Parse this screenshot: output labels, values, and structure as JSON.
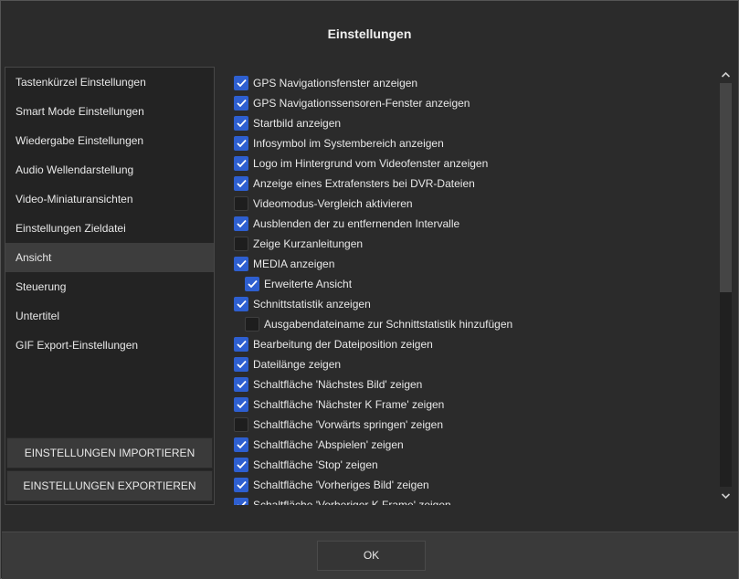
{
  "dialog": {
    "title": "Einstellungen"
  },
  "sidebar": {
    "items": [
      {
        "label": "Tastenkürzel Einstellungen"
      },
      {
        "label": "Smart Mode Einstellungen"
      },
      {
        "label": "Wiedergabe Einstellungen"
      },
      {
        "label": "Audio Wellendarstellung"
      },
      {
        "label": "Video-Miniaturansichten"
      },
      {
        "label": "Einstellungen Zieldatei"
      },
      {
        "label": "Ansicht",
        "active": true
      },
      {
        "label": "Steuerung"
      },
      {
        "label": "Untertitel"
      },
      {
        "label": "GIF Export-Einstellungen"
      }
    ],
    "import_label": "EINSTELLUNGEN IMPORTIEREN",
    "export_label": "EINSTELLUNGEN EXPORTIEREN"
  },
  "options": [
    {
      "label": "GPS Navigationsfenster anzeigen",
      "checked": true
    },
    {
      "label": "GPS Navigationssensoren-Fenster anzeigen",
      "checked": true
    },
    {
      "label": "Startbild anzeigen",
      "checked": true
    },
    {
      "label": "Infosymbol im Systembereich anzeigen",
      "checked": true
    },
    {
      "label": "Logo im Hintergrund vom Videofenster anzeigen",
      "checked": true
    },
    {
      "label": "Anzeige eines Extrafensters bei DVR-Dateien",
      "checked": true
    },
    {
      "label": "Videomodus-Vergleich aktivieren",
      "checked": false
    },
    {
      "label": "Ausblenden der zu entfernenden Intervalle",
      "checked": true
    },
    {
      "label": "Zeige Kurzanleitungen",
      "checked": false
    },
    {
      "label": "MEDIA anzeigen",
      "checked": true
    },
    {
      "label": "Erweiterte Ansicht",
      "checked": true,
      "indent": true
    },
    {
      "label": "Schnittstatistik anzeigen",
      "checked": true
    },
    {
      "label": "Ausgabendateiname zur Schnittstatistik hinzufügen",
      "checked": false,
      "indent": true
    },
    {
      "label": "Bearbeitung der Dateiposition zeigen",
      "checked": true
    },
    {
      "label": "Dateilänge zeigen",
      "checked": true
    },
    {
      "label": "Schaltfläche 'Nächstes Bild' zeigen",
      "checked": true
    },
    {
      "label": "Schaltfläche 'Nächster K Frame' zeigen",
      "checked": true
    },
    {
      "label": "Schaltfläche 'Vorwärts springen' zeigen",
      "checked": false
    },
    {
      "label": "Schaltfläche 'Abspielen' zeigen",
      "checked": true
    },
    {
      "label": "Schaltfläche 'Stop' zeigen",
      "checked": true
    },
    {
      "label": "Schaltfläche 'Vorheriges Bild' zeigen",
      "checked": true
    },
    {
      "label": "Schaltfläche 'Vorheriger K Frame' zeigen",
      "checked": true
    }
  ],
  "footer": {
    "ok_label": "OK"
  },
  "colors": {
    "accent": "#2e5fd0",
    "background": "#2b2b2b",
    "panel": "#232323",
    "active_item": "#3d3d3d"
  }
}
